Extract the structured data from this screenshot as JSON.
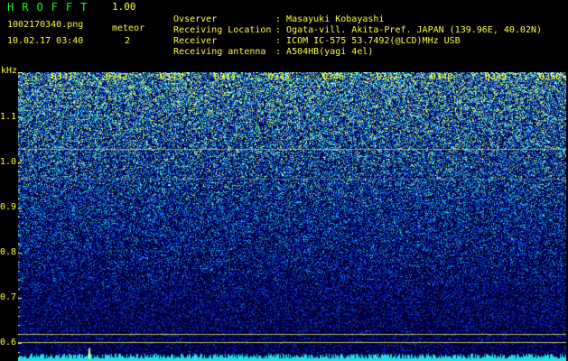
{
  "header": {
    "logo": "HROFFT",
    "version": "1.00",
    "filename": "1002170340.png",
    "datetime": "10.02.17 03:40",
    "meteor_label": "meteor",
    "meteor_count": "2"
  },
  "info": [
    {
      "key": "Ovserver",
      "value": "Masayuki Kobayashi"
    },
    {
      "key": "Receiving Location",
      "value": "Ogata-vill. Akita-Pref. JAPAN (139.96E, 40.02N)"
    },
    {
      "key": "Receiver",
      "value": "ICOM IC-575 53.7492(@LCD)MHz USB"
    },
    {
      "key": "Receiving antenna",
      "value": "A504HB(yagi 4el)"
    }
  ],
  "separator": ":",
  "spectrogram": {
    "y_unit": "kHz",
    "y_ticks": [
      "1.1",
      "1.0",
      "0.9",
      "0.8",
      "0.7",
      "0.6"
    ],
    "y_values": [
      1.1,
      1.0,
      0.9,
      0.8,
      0.7,
      0.6
    ],
    "y_range": [
      0.58,
      1.22
    ],
    "x_ticks": [
      "0341",
      "0342",
      "0343",
      "0344",
      "0345",
      "0346",
      "0347",
      "0348",
      "0349",
      "0350"
    ],
    "colors": {
      "background": "#000030",
      "low": "#00009a",
      "mid": "#1060e0",
      "high": "#20e0e0",
      "peak": "#e0ff60",
      "lines": "#ffff66",
      "labels": "#ffff33",
      "logo": "#22ee22"
    }
  }
}
